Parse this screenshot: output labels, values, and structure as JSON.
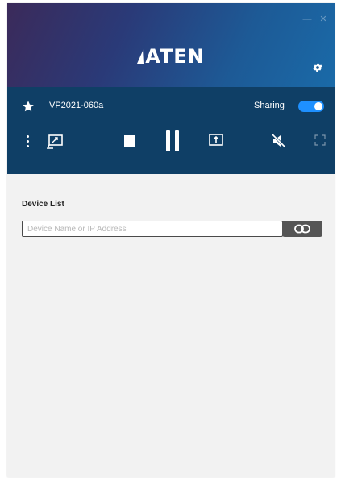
{
  "header": {
    "logo_text": "ATEN",
    "icons": [
      "minimize-icon",
      "close-icon",
      "gear-icon"
    ]
  },
  "session": {
    "device_name": "VP2021-060a",
    "sharing_label": "Sharing",
    "sharing_on": true,
    "toolbar_icons": [
      "more-options-icon",
      "screen-mirror-icon",
      "stop-icon",
      "pause-icon",
      "upload-icon",
      "mute-icon",
      "fullscreen-icon"
    ]
  },
  "device_list": {
    "title": "Device List",
    "input_placeholder": "Device Name or IP Address",
    "input_value": "",
    "connect_icon": "link-icon"
  },
  "colors": {
    "control_bar": "#0f3f66",
    "toggle_on": "#1e90ff",
    "connect_button": "#555555",
    "content_bg": "#f2f2f2"
  }
}
